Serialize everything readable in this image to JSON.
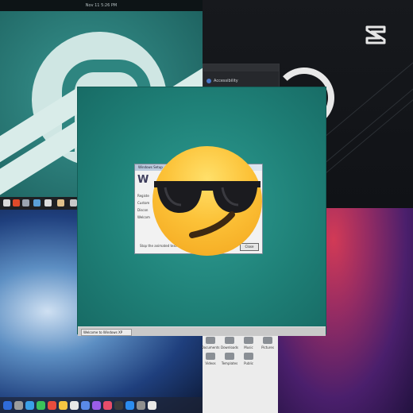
{
  "status_bar": {
    "clock": "Nov 11  5:26 PM"
  },
  "settings_panel": {
    "item": "Accessibility"
  },
  "install_window": {
    "title": "Windows Setup",
    "banner": "W",
    "steps": [
      "Registe",
      "Custom",
      "Discon",
      "Welcom"
    ],
    "footer": "Stop the animated text",
    "close_button": "Close",
    "taskbar_button": "Welcome to Windows XP"
  },
  "file_manager": {
    "row1": [
      "Documents",
      "Downloads",
      "Music",
      "Pictures"
    ],
    "row2": [
      "Videos",
      "Templates",
      "Public",
      ""
    ]
  },
  "watermark": {
    "brand": "capcut-logo"
  },
  "overlay": {
    "emoji": "smiling-face-with-sunglasses"
  },
  "colors": {
    "teal_accent": "#1f8178",
    "wallpaper_red": "#d23a56",
    "wallpaper_blue": "#1f3f7d",
    "emoji_yellow": "#fcc238"
  }
}
